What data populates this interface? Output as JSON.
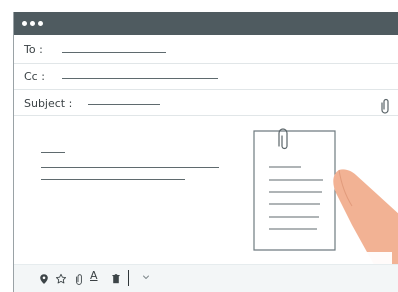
{
  "window": {
    "title_dots": 3
  },
  "fields": {
    "to_label": "To :",
    "cc_label": "Cc :",
    "subject_label": "Subject :"
  },
  "icons": {
    "window_dots": "window-control-dots-icon",
    "subject_attach": "paperclip-icon",
    "document": "document-icon",
    "hand": "hand-illustration",
    "location": "location-pin-icon",
    "star": "star-icon",
    "attach": "paperclip-icon",
    "text_format": "text-format-icon",
    "trash": "trash-icon",
    "more": "chevron-down-icon"
  },
  "toolbar": {
    "format_label": "A"
  },
  "colors": {
    "titlebar": "#4f5b60",
    "line": "#5f6a6e",
    "footer": "#f3f6f7",
    "skin": "#f2b294",
    "paper_border": "#6f7b80"
  }
}
